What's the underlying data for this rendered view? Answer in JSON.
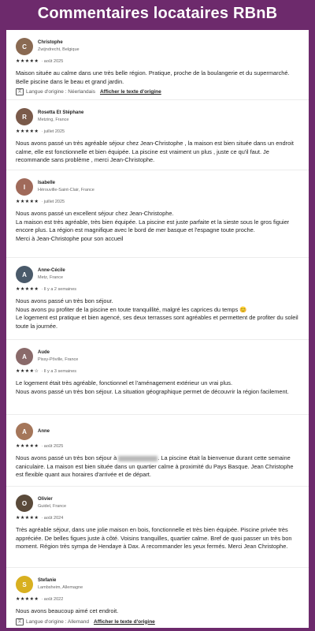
{
  "banner": {
    "title": "Commentaires locataires RBnB"
  },
  "reviews": [
    {
      "name": "Christophe",
      "location": "Zwijndrecht, Belgique",
      "stars": "★★★★★",
      "date": "août 2025",
      "text": "Maison située au calme dans une très belle région. Pratique, proche de la boulangerie et du supermarché. Belle piscine dans le beau et grand jardin.",
      "lang_label": "Langue d'origine : Néerlandais",
      "lang_link": "Afficher le texte d'origine",
      "avatar_color": "#8a6a52"
    },
    {
      "name": "Rosetta Et Stéphane",
      "location": "Metzing, France",
      "stars": "★★★★★",
      "date": "juillet 2025",
      "text": "Nous avons passé un très agréable séjour chez Jean-Christophe , la maison est bien située dans un endroit calme, elle est fonctionnelle et bien équipée. La piscine est vraiment un plus , juste ce qu'il faut. Je recommande sans problème , merci Jean-Christophe.",
      "avatar_color": "#7a5a4a"
    },
    {
      "name": "Isabelle",
      "location": "Hérouville-Saint-Clair, France",
      "stars": "★★★★★",
      "date": "juillet 2025",
      "text": "Nous avons passé un excellent séjour chez Jean-Christophe.\nLa maison est très agréable, très bien équipée. La piscine est juste parfaite et la sieste sous le gros figuier encore plus. La région est magnifique avec le bord de mer basque et l'espagne toute proche.\nMerci à Jean-Christophe pour son accueil",
      "avatar_color": "#a06a5a"
    },
    {
      "name": "Anne-Cécile",
      "location": "Metz, France",
      "stars": "★★★★★",
      "date": "Il y a 2 semaines",
      "text": "Nous avons passé un très bon séjour.\nNous avons pu profiter de la piscine en toute tranquillité, malgré les caprices du temps 😊\nLe logement est pratique et bien agencé, ses deux terrasses sont agréables et permettent de profiter du soleil toute la journée.",
      "avatar_color": "#4a5a6a"
    },
    {
      "name": "Aude",
      "location": "Pissy-Pôville, France",
      "stars": "★★★★☆",
      "date": "Il y a 3 semaines",
      "text": "Le logement était très agréable, fonctionnel et l'aménagement extérieur un vrai plus.\nNous avons passé un très bon séjour. La situation géographique permet de découvrir la région facilement.",
      "avatar_color": "#8a6a6a"
    },
    {
      "name": "Anne",
      "location": "",
      "stars": "★★★★★",
      "date": "août 2025",
      "text_a": "Nous avons passé un très bon séjour à",
      "text_b": ". La piscine était la bienvenue durant cette semaine caniculaire. La maison est bien située dans un quartier calme à proximité du Pays Basque. Jean Christophe est flexible quant aux horaires d'arrivée et de départ.",
      "avatar_color": "#a5765a"
    },
    {
      "name": "Olivier",
      "location": "Guidel, France",
      "stars": "★★★★★",
      "date": "août 2024",
      "text": "Très agréable séjour, dans une jolie maison en bois, fonctionnelle et très bien équipée. Piscine privée très appréciée. De belles figues juste à côté. Voisins tranquilles, quartier calme. Bref de quoi passer un très bon moment. Région très sympa de Hendaye à Dax. A recommander les yeux fermés. Merci Jean Christophe.",
      "avatar_color": "#5a4a3a"
    },
    {
      "name": "Stefanie",
      "location": "Lambsheim, Allemagne",
      "stars": "★★★★★",
      "date": "août 2022",
      "text": "Nous avons beaucoup aimé cet endroit.",
      "lang_label": "Langue d'origine : Allemand",
      "lang_link": "Afficher le texte d'origine",
      "avatar_color": "#d8b020"
    }
  ]
}
